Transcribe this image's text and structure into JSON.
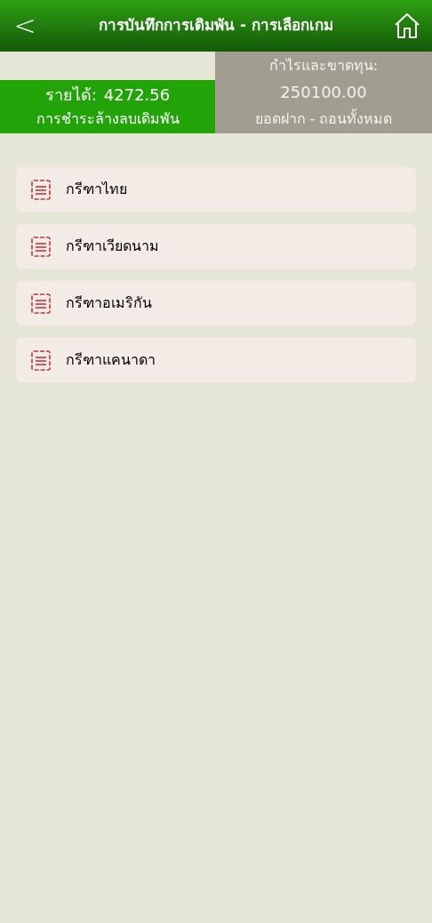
{
  "header": {
    "back": "<",
    "title": "การบันทึกการเดิมพัน - การเลือกเกม"
  },
  "summary": {
    "income_label": "รายได้:",
    "income_value": "4272.56",
    "settlement_label": "การชำระล้างลบเดิมพัน",
    "profit_label": "กำไรและขาดทุน:",
    "profit_value": "250100.00",
    "deposit_label": "ยอดฝาก - ถอนทั้งหมด"
  },
  "games": [
    {
      "label": "กรีฑาไทย"
    },
    {
      "label": "กรีฑาเวียดนาม"
    },
    {
      "label": "กรีฑาอเมริกัน"
    },
    {
      "label": "กรีฑาแคนาดา"
    }
  ]
}
